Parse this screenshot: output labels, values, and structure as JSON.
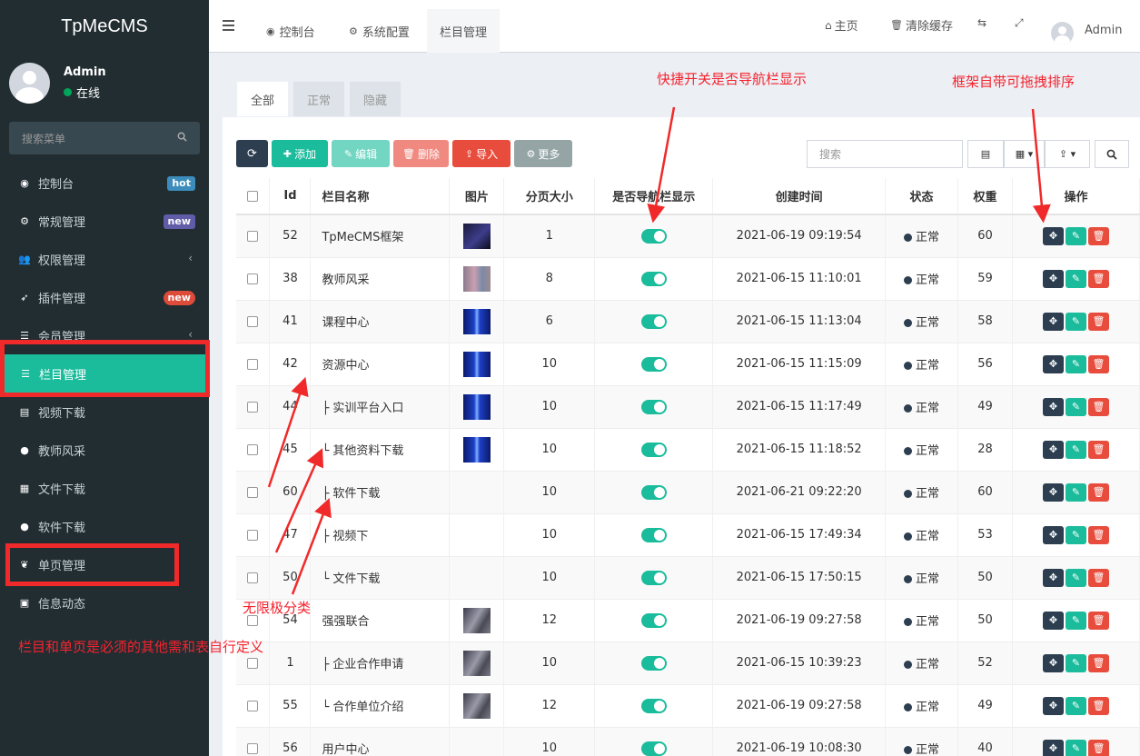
{
  "app": {
    "title": "TpMeCMS"
  },
  "user": {
    "name": "Admin",
    "status": "在线"
  },
  "sidebar": {
    "search_placeholder": "搜索菜单",
    "items": [
      {
        "label": "控制台",
        "icon": "dashboard-icon",
        "badge": "hot",
        "badge_color": "#3c8dbc"
      },
      {
        "label": "常规管理",
        "icon": "cogs-icon",
        "badge": "new",
        "badge_color": "#605ca8"
      },
      {
        "label": "权限管理",
        "icon": "group-icon"
      },
      {
        "label": "插件管理",
        "icon": "rocket-icon",
        "badge": "new",
        "badge_color": "#dd4b39"
      },
      {
        "label": "会员管理",
        "icon": "list-icon"
      },
      {
        "label": "栏目管理",
        "icon": "list-icon"
      },
      {
        "label": "视频下载",
        "icon": "file-icon"
      },
      {
        "label": "教师风采",
        "icon": "user-icon"
      },
      {
        "label": "文件下载",
        "icon": "file-word-icon"
      },
      {
        "label": "软件下载",
        "icon": "apple-icon"
      },
      {
        "label": "单页管理",
        "icon": "leaf-icon"
      },
      {
        "label": "信息动态",
        "icon": "newspaper-icon"
      }
    ]
  },
  "header": {
    "tabs": [
      {
        "label": "控制台",
        "icon": "dashboard-icon"
      },
      {
        "label": "系统配置",
        "icon": "gear-icon"
      },
      {
        "label": "栏目管理",
        "icon": ""
      }
    ],
    "home": "主页",
    "clear_cache": "清除缓存",
    "admin": "Admin"
  },
  "filters": [
    "全部",
    "正常",
    "隐藏"
  ],
  "toolbar": {
    "add": "添加",
    "edit": "编辑",
    "delete": "删除",
    "import": "导入",
    "more": "更多",
    "search_placeholder": "搜索"
  },
  "table": {
    "columns": [
      "Id",
      "栏目名称",
      "图片",
      "分页大小",
      "是否导航栏显示",
      "创建时间",
      "状态",
      "权重",
      "操作"
    ],
    "rows": [
      {
        "id": "52",
        "name": "TpMeCMS框架",
        "img": "dark",
        "page_size": "1",
        "created": "2021-06-19 09:19:54",
        "status": "正常",
        "weight": "60"
      },
      {
        "id": "38",
        "name": "教师风采",
        "img": "blur",
        "page_size": "8",
        "created": "2021-06-15 11:10:01",
        "status": "正常",
        "weight": "59"
      },
      {
        "id": "41",
        "name": "课程中心",
        "img": "blue",
        "page_size": "6",
        "created": "2021-06-15 11:13:04",
        "status": "正常",
        "weight": "58"
      },
      {
        "id": "42",
        "name": "资源中心",
        "img": "blue",
        "page_size": "10",
        "created": "2021-06-15 11:15:09",
        "status": "正常",
        "weight": "56"
      },
      {
        "id": "44",
        "name": "├ 实训平台入口",
        "img": "blue",
        "page_size": "10",
        "created": "2021-06-15 11:17:49",
        "status": "正常",
        "weight": "49"
      },
      {
        "id": "45",
        "name": "└ 其他资料下载",
        "img": "blue",
        "page_size": "10",
        "created": "2021-06-15 11:18:52",
        "status": "正常",
        "weight": "28"
      },
      {
        "id": "60",
        "name": "├ 软件下载",
        "img": "",
        "page_size": "10",
        "created": "2021-06-21 09:22:20",
        "status": "正常",
        "weight": "60"
      },
      {
        "id": "47",
        "name": "├ 视频下",
        "img": "",
        "page_size": "10",
        "created": "2021-06-15 17:49:34",
        "status": "正常",
        "weight": "53"
      },
      {
        "id": "50",
        "name": "└ 文件下载",
        "img": "",
        "page_size": "10",
        "created": "2021-06-15 17:50:15",
        "status": "正常",
        "weight": "50"
      },
      {
        "id": "54",
        "name": "强强联合",
        "img": "gray",
        "page_size": "12",
        "created": "2021-06-19 09:27:58",
        "status": "正常",
        "weight": "50"
      },
      {
        "id": "1",
        "name": "├ 企业合作申请",
        "img": "gray",
        "page_size": "10",
        "created": "2021-06-15 10:39:23",
        "status": "正常",
        "weight": "52"
      },
      {
        "id": "55",
        "name": "└ 合作单位介绍",
        "img": "gray",
        "page_size": "12",
        "created": "2021-06-19 09:27:58",
        "status": "正常",
        "weight": "49"
      },
      {
        "id": "56",
        "name": "用户中心",
        "img": "",
        "page_size": "10",
        "created": "2021-06-19 10:08:30",
        "status": "正常",
        "weight": "40"
      }
    ]
  },
  "annotations": {
    "nav_toggle": "快捷开关是否导航栏显示",
    "drag_sort": "框架自带可拖拽排序",
    "infinite": "无限极分类",
    "required": "栏目和单页是必须的其他需和表自行定义"
  },
  "colors": {
    "accent": "#1abc9c",
    "sidebar": "#222d32",
    "annotation": "#f02a2a"
  }
}
